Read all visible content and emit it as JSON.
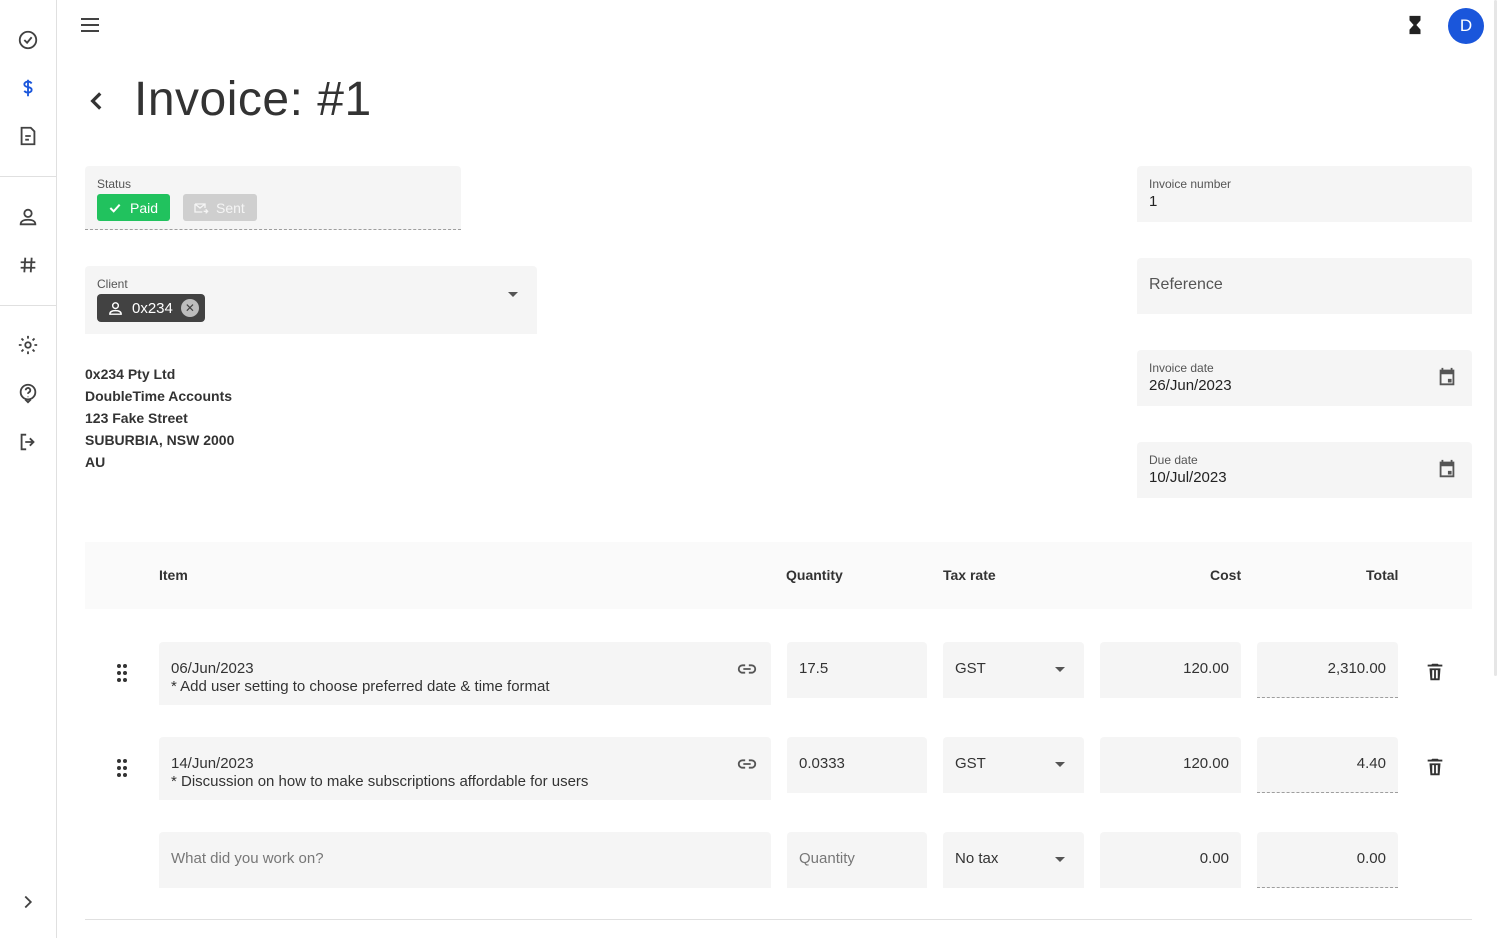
{
  "page": {
    "title": "Invoice: #1",
    "avatar_initial": "D"
  },
  "status": {
    "label": "Status",
    "paid_label": "Paid",
    "sent_label": "Sent"
  },
  "client": {
    "label": "Client",
    "chip": "0x234"
  },
  "address": [
    "0x234 Pty Ltd",
    "DoubleTime Accounts",
    "123 Fake Street",
    "SUBURBIA, NSW 2000",
    "AU"
  ],
  "invoice_number": {
    "label": "Invoice number",
    "value": "1"
  },
  "reference": {
    "placeholder": "Reference"
  },
  "invoice_date": {
    "label": "Invoice date",
    "value": "26/Jun/2023"
  },
  "due_date": {
    "label": "Due date",
    "value": "10/Jul/2023"
  },
  "table": {
    "headers": {
      "item": "Item",
      "quantity": "Quantity",
      "tax_rate": "Tax rate",
      "cost": "Cost",
      "total": "Total"
    },
    "rows": [
      {
        "date": "06/Jun/2023",
        "description": "* Add user setting to choose preferred date & time format",
        "quantity": "17.5",
        "tax": "GST",
        "cost": "120.00",
        "total": "2,310.00"
      },
      {
        "date": "14/Jun/2023",
        "description": "* Discussion on how to make subscriptions affordable for users",
        "quantity": "0.0333",
        "tax": "GST",
        "cost": "120.00",
        "total": "4.40"
      }
    ],
    "new_row": {
      "item_placeholder": "What did you work on?",
      "quantity_placeholder": "Quantity",
      "tax": "No tax",
      "cost": "0.00",
      "total": "0.00"
    }
  },
  "icons": {
    "rail": [
      "check-circle-icon",
      "dollar-icon",
      "receipt-icon",
      "person-icon",
      "hash-icon",
      "gear-icon",
      "help-icon",
      "logout-icon",
      "chevron-right-icon"
    ],
    "accent": "#1a56db",
    "paid_color": "#21c25e"
  }
}
